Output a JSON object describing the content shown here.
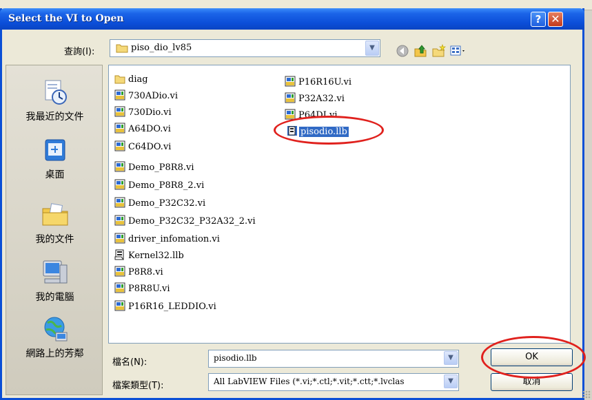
{
  "window": {
    "title": "Select the VI to Open",
    "help_label": "?",
    "close_label": "✕"
  },
  "lookin": {
    "label": "查詢(I):",
    "value": "piso_dio_lv85"
  },
  "toolbar": {
    "icons": [
      "back-icon",
      "up-folder-icon",
      "new-folder-icon",
      "view-menu-icon"
    ]
  },
  "places": {
    "items": [
      {
        "label": "我最近的文件",
        "icon": "recent-documents-icon"
      },
      {
        "label": "桌面",
        "icon": "desktop-icon"
      },
      {
        "label": "我的文件",
        "icon": "my-documents-icon"
      },
      {
        "label": "我的電腦",
        "icon": "my-computer-icon"
      },
      {
        "label": "網路上的芳鄰",
        "icon": "network-places-icon"
      }
    ]
  },
  "files": {
    "column1": [
      {
        "name": "diag",
        "type": "folder"
      },
      {
        "name": "730ADio.vi",
        "type": "vi"
      },
      {
        "name": "730Dio.vi",
        "type": "vi"
      },
      {
        "name": "A64DO.vi",
        "type": "vi"
      },
      {
        "name": "C64DO.vi",
        "type": "vi"
      },
      {
        "name": "Demo_P8R8.vi",
        "type": "vi"
      },
      {
        "name": "Demo_P8R8_2.vi",
        "type": "vi"
      },
      {
        "name": "Demo_P32C32.vi",
        "type": "vi"
      },
      {
        "name": "Demo_P32C32_P32A32_2.vi",
        "type": "vi"
      },
      {
        "name": "driver_infomation.vi",
        "type": "vi"
      },
      {
        "name": "Kernel32.llb",
        "type": "llb"
      },
      {
        "name": "P8R8.vi",
        "type": "vi"
      },
      {
        "name": "P8R8U.vi",
        "type": "vi"
      },
      {
        "name": "P16R16_LEDDIO.vi",
        "type": "vi"
      }
    ],
    "column2": [
      {
        "name": "P16R16U.vi",
        "type": "vi"
      },
      {
        "name": "P32A32.vi",
        "type": "vi"
      },
      {
        "name": "P64DI.vi",
        "type": "vi"
      },
      {
        "name": "pisodio.llb",
        "type": "llb",
        "selected": true
      }
    ]
  },
  "filename": {
    "label": "檔名(N):",
    "value": "pisodio.llb"
  },
  "filetype": {
    "label": "檔案類型(T):",
    "value": "All LabVIEW Files (*.vi;*.ctl;*.vit;*.ctt;*.lvclas"
  },
  "buttons": {
    "ok": "OK",
    "cancel": "取消"
  },
  "colors": {
    "titlebar": "#0b4ed8",
    "selection": "#316ac5",
    "highlight_circle": "#e0211d"
  }
}
